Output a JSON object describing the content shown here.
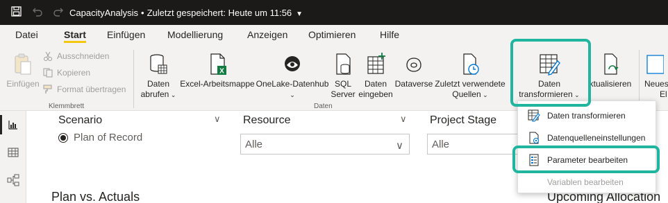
{
  "titlebar": {
    "file_name": "CapacityAnalysis",
    "saved_status": "Zuletzt gespeichert: Heute um 11:56"
  },
  "tabs": [
    {
      "label": "Datei"
    },
    {
      "label": "Start"
    },
    {
      "label": "Einfügen"
    },
    {
      "label": "Modellierung"
    },
    {
      "label": "Anzeigen"
    },
    {
      "label": "Optimieren"
    },
    {
      "label": "Hilfe"
    }
  ],
  "ribbon": {
    "paste_label": "Einfügen",
    "cut_label": "Ausschneiden",
    "copy_label": "Kopieren",
    "format_painter_label": "Format übertragen",
    "clipboard_group": "Klemmbrett",
    "get_data_line1": "Daten",
    "get_data_line2": "abrufen",
    "excel_label": "Excel-Arbeitsmappe",
    "onelake_label": "OneLake-Datenhub",
    "sql_line1": "SQL",
    "sql_line2": "Server",
    "enter_data_line1": "Daten",
    "enter_data_line2": "eingeben",
    "dataverse_label": "Dataverse",
    "recent_line1": "Zuletzt verwendete",
    "recent_line2": "Quellen",
    "data_group": "Daten",
    "transform_line1": "Daten",
    "transform_line2": "transformieren",
    "refresh_label": "ktualisieren",
    "new_line1": "Neues",
    "new_line2": "El"
  },
  "leftnav": [
    {
      "icon": "report-view-icon"
    },
    {
      "icon": "table-view-icon"
    },
    {
      "icon": "model-view-icon"
    }
  ],
  "canvas": {
    "scenario_title": "Scenario",
    "scenario_option": "Plan of Record",
    "resource_title": "Resource",
    "resource_value": "Alle",
    "project_stage_title": "Project Stage",
    "project_stage_value": "Alle",
    "plan_vs_actuals": "Plan vs. Actuals",
    "upcoming_allocation": "Upcoming Allocation"
  },
  "menu": {
    "items": [
      {
        "label": "Daten transformieren",
        "icon": "transform-data-icon",
        "enabled": true
      },
      {
        "label": "Datenquelleneinstellungen",
        "icon": "data-source-settings-icon",
        "enabled": true
      },
      {
        "label": "Parameter bearbeiten",
        "icon": "edit-parameters-icon",
        "enabled": true
      },
      {
        "label": "Variablen bearbeiten",
        "icon": "edit-variables-icon",
        "enabled": false
      }
    ]
  },
  "colors": {
    "highlight": "#1fb59f",
    "titlebar_bg": "#1b1a19",
    "ribbon_bg": "#f3f2f1",
    "active_tab_underline": "#f2c811"
  }
}
